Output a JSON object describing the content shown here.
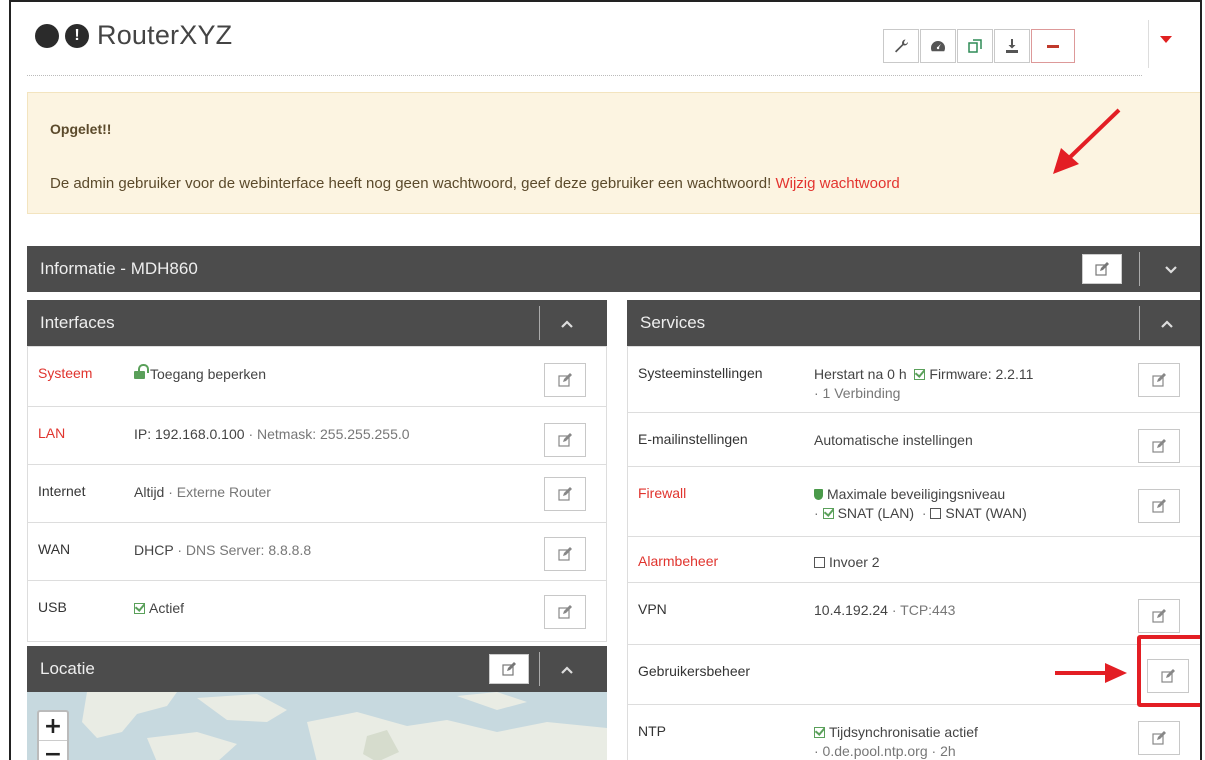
{
  "header": {
    "title": "RouterXYZ",
    "toolbar": {
      "tools_icon": "wrench-icon",
      "dashboard_icon": "dashboard-icon",
      "restart_icon": "restart-icon",
      "download_icon": "download-icon",
      "logout_icon": "minus-icon",
      "menu_icon": "caret-down-icon"
    }
  },
  "alert": {
    "title": "Opgelet!!",
    "message": "De admin gebruiker voor de webinterface heeft nog geen wachtwoord, geef deze gebruiker een wachtwoord!",
    "link": "Wijzig wachtwoord"
  },
  "info_panel": {
    "title": "Informatie - MDH860"
  },
  "interfaces": {
    "title": "Interfaces",
    "rows": [
      {
        "label": "Systeem",
        "status_color": "#e0342e",
        "value": "Toegang beperken"
      },
      {
        "label": "LAN",
        "status_color": "#e0342e",
        "value": "IP: 192.168.0.100",
        "value2": "· Netmask: 255.255.255.0"
      },
      {
        "label": "Internet",
        "value": "Altijd",
        "value2": "· Externe Router"
      },
      {
        "label": "WAN",
        "value": "DHCP",
        "value2": "· DNS Server: 8.8.8.8"
      },
      {
        "label": "USB",
        "value": "Actief"
      }
    ]
  },
  "locatie": {
    "title": "Locatie",
    "zoom_in": "+",
    "zoom_out": "−"
  },
  "services": {
    "title": "Services",
    "rows": [
      {
        "label": "Systeeminstellingen",
        "value": "Herstart na 0 h",
        "value2": "Firmware: 2.2.11",
        "value3": "· 1 Verbinding"
      },
      {
        "label": "E-mailinstellingen",
        "value": "Automatische instellingen"
      },
      {
        "label": "Firewall",
        "status_color": "#e0342e",
        "value": "Maximale beveiligingsniveau",
        "value2": "SNAT (LAN)",
        "value3": "SNAT (WAN)"
      },
      {
        "label": "Alarmbeheer",
        "status_color": "#e0342e",
        "value": "Invoer 2"
      },
      {
        "label": "VPN",
        "value": "10.4.192.24",
        "value2": "· TCP:443"
      },
      {
        "label": "Gebruikersbeheer",
        "value": ""
      },
      {
        "label": "NTP",
        "value": "Tijdsynchronisatie actief",
        "value2": "· 0.de.pool.ntp.org",
        "value3": "· 2h"
      }
    ]
  },
  "colors": {
    "accent_red": "#e3342f",
    "panel_header": "#4c4c4c",
    "alert_bg": "#fcf4e1",
    "ok_green": "#5aa05a"
  }
}
